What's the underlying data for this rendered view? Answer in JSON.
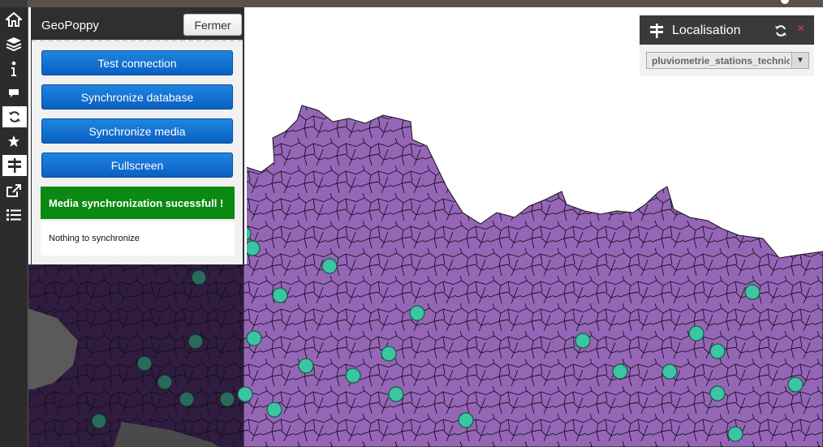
{
  "sidebar": {
    "icons": [
      {
        "name": "home-icon",
        "active": false
      },
      {
        "name": "layers-icon",
        "active": false
      },
      {
        "name": "info-icon",
        "active": false
      },
      {
        "name": "comment-icon",
        "active": false
      },
      {
        "name": "sync-icon",
        "active": true
      },
      {
        "name": "star-icon",
        "active": false
      },
      {
        "name": "signpost-icon",
        "active": true
      },
      {
        "name": "share-icon",
        "active": false
      },
      {
        "name": "list-icon",
        "active": false
      }
    ]
  },
  "panel": {
    "title": "GeoPoppy",
    "close_label": "Fermer",
    "buttons": [
      {
        "label": "Test connection"
      },
      {
        "label": "Synchronize database"
      },
      {
        "label": "Synchronize media"
      },
      {
        "label": "Fullscreen"
      }
    ],
    "success_message": "Media synchronization sucessfull !",
    "info_message": "Nothing to synchronize"
  },
  "localisation": {
    "title": "Localisation",
    "close_symbol": "×",
    "selected_layer": "pluviometrie_stations_technicentre",
    "arrow": "▼"
  },
  "colors": {
    "map_fill": "#9566b6",
    "map_fill_dark": "#301c40",
    "station_fill": "#3cc5a3",
    "button_blue": "#0a5fc2",
    "success_green": "#0b8a13"
  },
  "stations_count_visible": 31
}
